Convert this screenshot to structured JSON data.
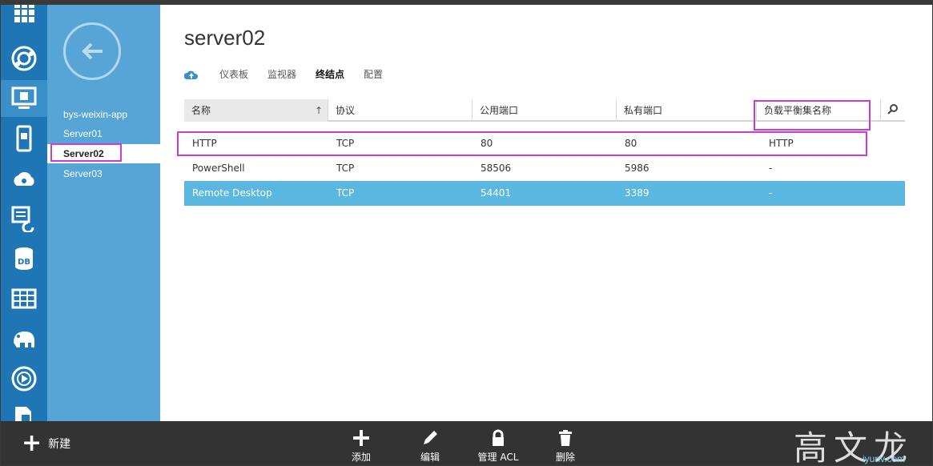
{
  "window": {
    "title": "server02"
  },
  "subnav": {
    "items": [
      "bys-weixin-app",
      "Server01",
      "Server02",
      "Server03"
    ],
    "selected": "Server02"
  },
  "tabs": [
    "仪表板",
    "监视器",
    "终结点",
    "配置"
  ],
  "table": {
    "columns": [
      "名称",
      "协议",
      "公用端口",
      "私有端口",
      "负载平衡集名称"
    ],
    "rows": [
      [
        "HTTP",
        "TCP",
        "80",
        "80",
        "HTTP"
      ],
      [
        "PowerShell",
        "TCP",
        "58506",
        "5986",
        "-"
      ],
      [
        "Remote Desktop",
        "TCP",
        "54401",
        "3389",
        "-"
      ]
    ]
  },
  "bottombar": {
    "new_label": "新建",
    "actions": [
      "添加",
      "编辑",
      "管理 ACL",
      "删除"
    ]
  },
  "watermark": {
    "text": "高文龙",
    "url": "iyunv.com"
  },
  "colors": {
    "rail": "#1f76b4",
    "subnav": "#56a5d6",
    "highlight_row": "#59b7e0",
    "annotation": "#c83bd4",
    "bottombar": "#333333"
  }
}
